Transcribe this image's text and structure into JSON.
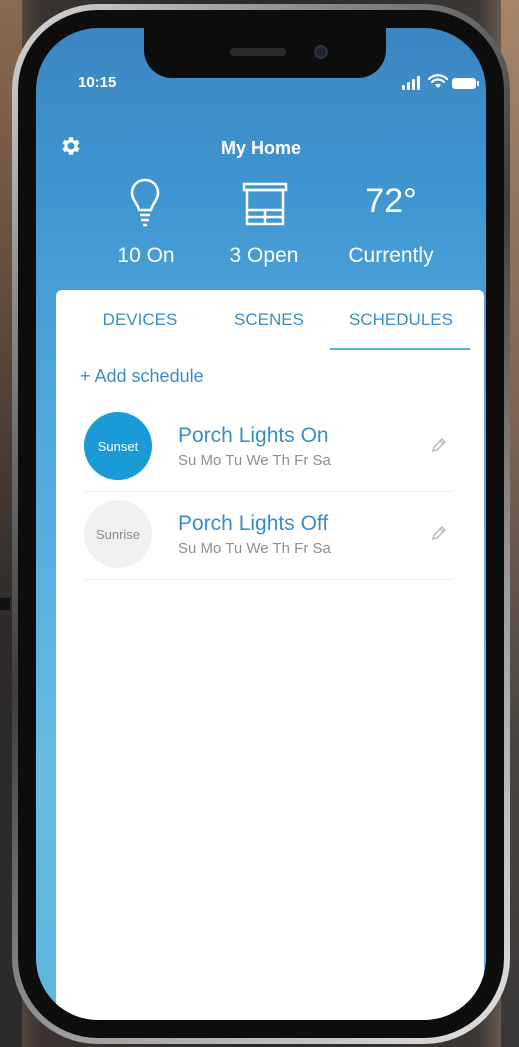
{
  "status_bar": {
    "time": "10:15"
  },
  "header": {
    "title": "My Home"
  },
  "stats": [
    {
      "icon": "lightbulb-icon",
      "label": "10 On"
    },
    {
      "icon": "window-shade-icon",
      "label": "3 Open"
    },
    {
      "value": "72°",
      "label": "Currently"
    }
  ],
  "tabs": [
    {
      "label": "DEVICES"
    },
    {
      "label": "SCENES"
    },
    {
      "label": "SCHEDULES"
    }
  ],
  "selected_tab": "SCHEDULES",
  "add_schedule_label": "+ Add schedule",
  "schedules": [
    {
      "badge": "Sunset",
      "name": "Porch Lights On",
      "days": "Su Mo Tu We Th Fr Sa"
    },
    {
      "badge": "Sunrise",
      "name": "Porch Lights Off",
      "days": "Su Mo Tu We Th Fr Sa"
    }
  ],
  "colors": {
    "accent": "#3a8ec8",
    "sunset_badge": "#1a9bd7",
    "sunrise_badge": "#f1f1f1",
    "header_gradient_top": "#3c86c2"
  }
}
